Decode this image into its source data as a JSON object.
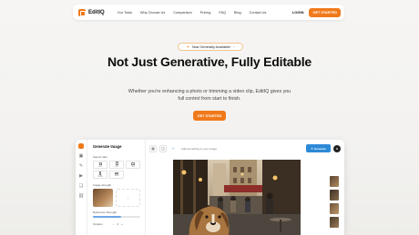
{
  "nav": {
    "brand": "EditIQ",
    "links": [
      "Our Tools",
      "Why Choose Us",
      "Comparison",
      "Pricing",
      "FAQ",
      "Blog",
      "Contact Us"
    ],
    "login": "LOGIN",
    "cta": "GET STARTED"
  },
  "hero": {
    "badge": "Now Generally Available!",
    "title": "Not Just Generative, Fully Editable",
    "subtitle": "Whether you're enhancing a photo or trimming a video clip, EditIQ gives you full control from start to finish.",
    "cta": "GET STARTED"
  },
  "app": {
    "panel_title": "Generate Image",
    "aspect_label": "Aspect ratio",
    "aspect_options": [
      "1:1",
      "3:4",
      "4:3",
      "9:16",
      "16:9"
    ],
    "image_strength_label": "Image strength",
    "reference_strength_label": "Reference Strength",
    "reference_strength_value": 0.6,
    "outputs_label": "Outputs",
    "outputs_value": "4",
    "prompt_placeholder": "Add something to your image",
    "generate_label": "Generate",
    "avatar_initial": "M"
  },
  "colors": {
    "accent": "#f07a1a",
    "generate": "#2d8ad8"
  }
}
